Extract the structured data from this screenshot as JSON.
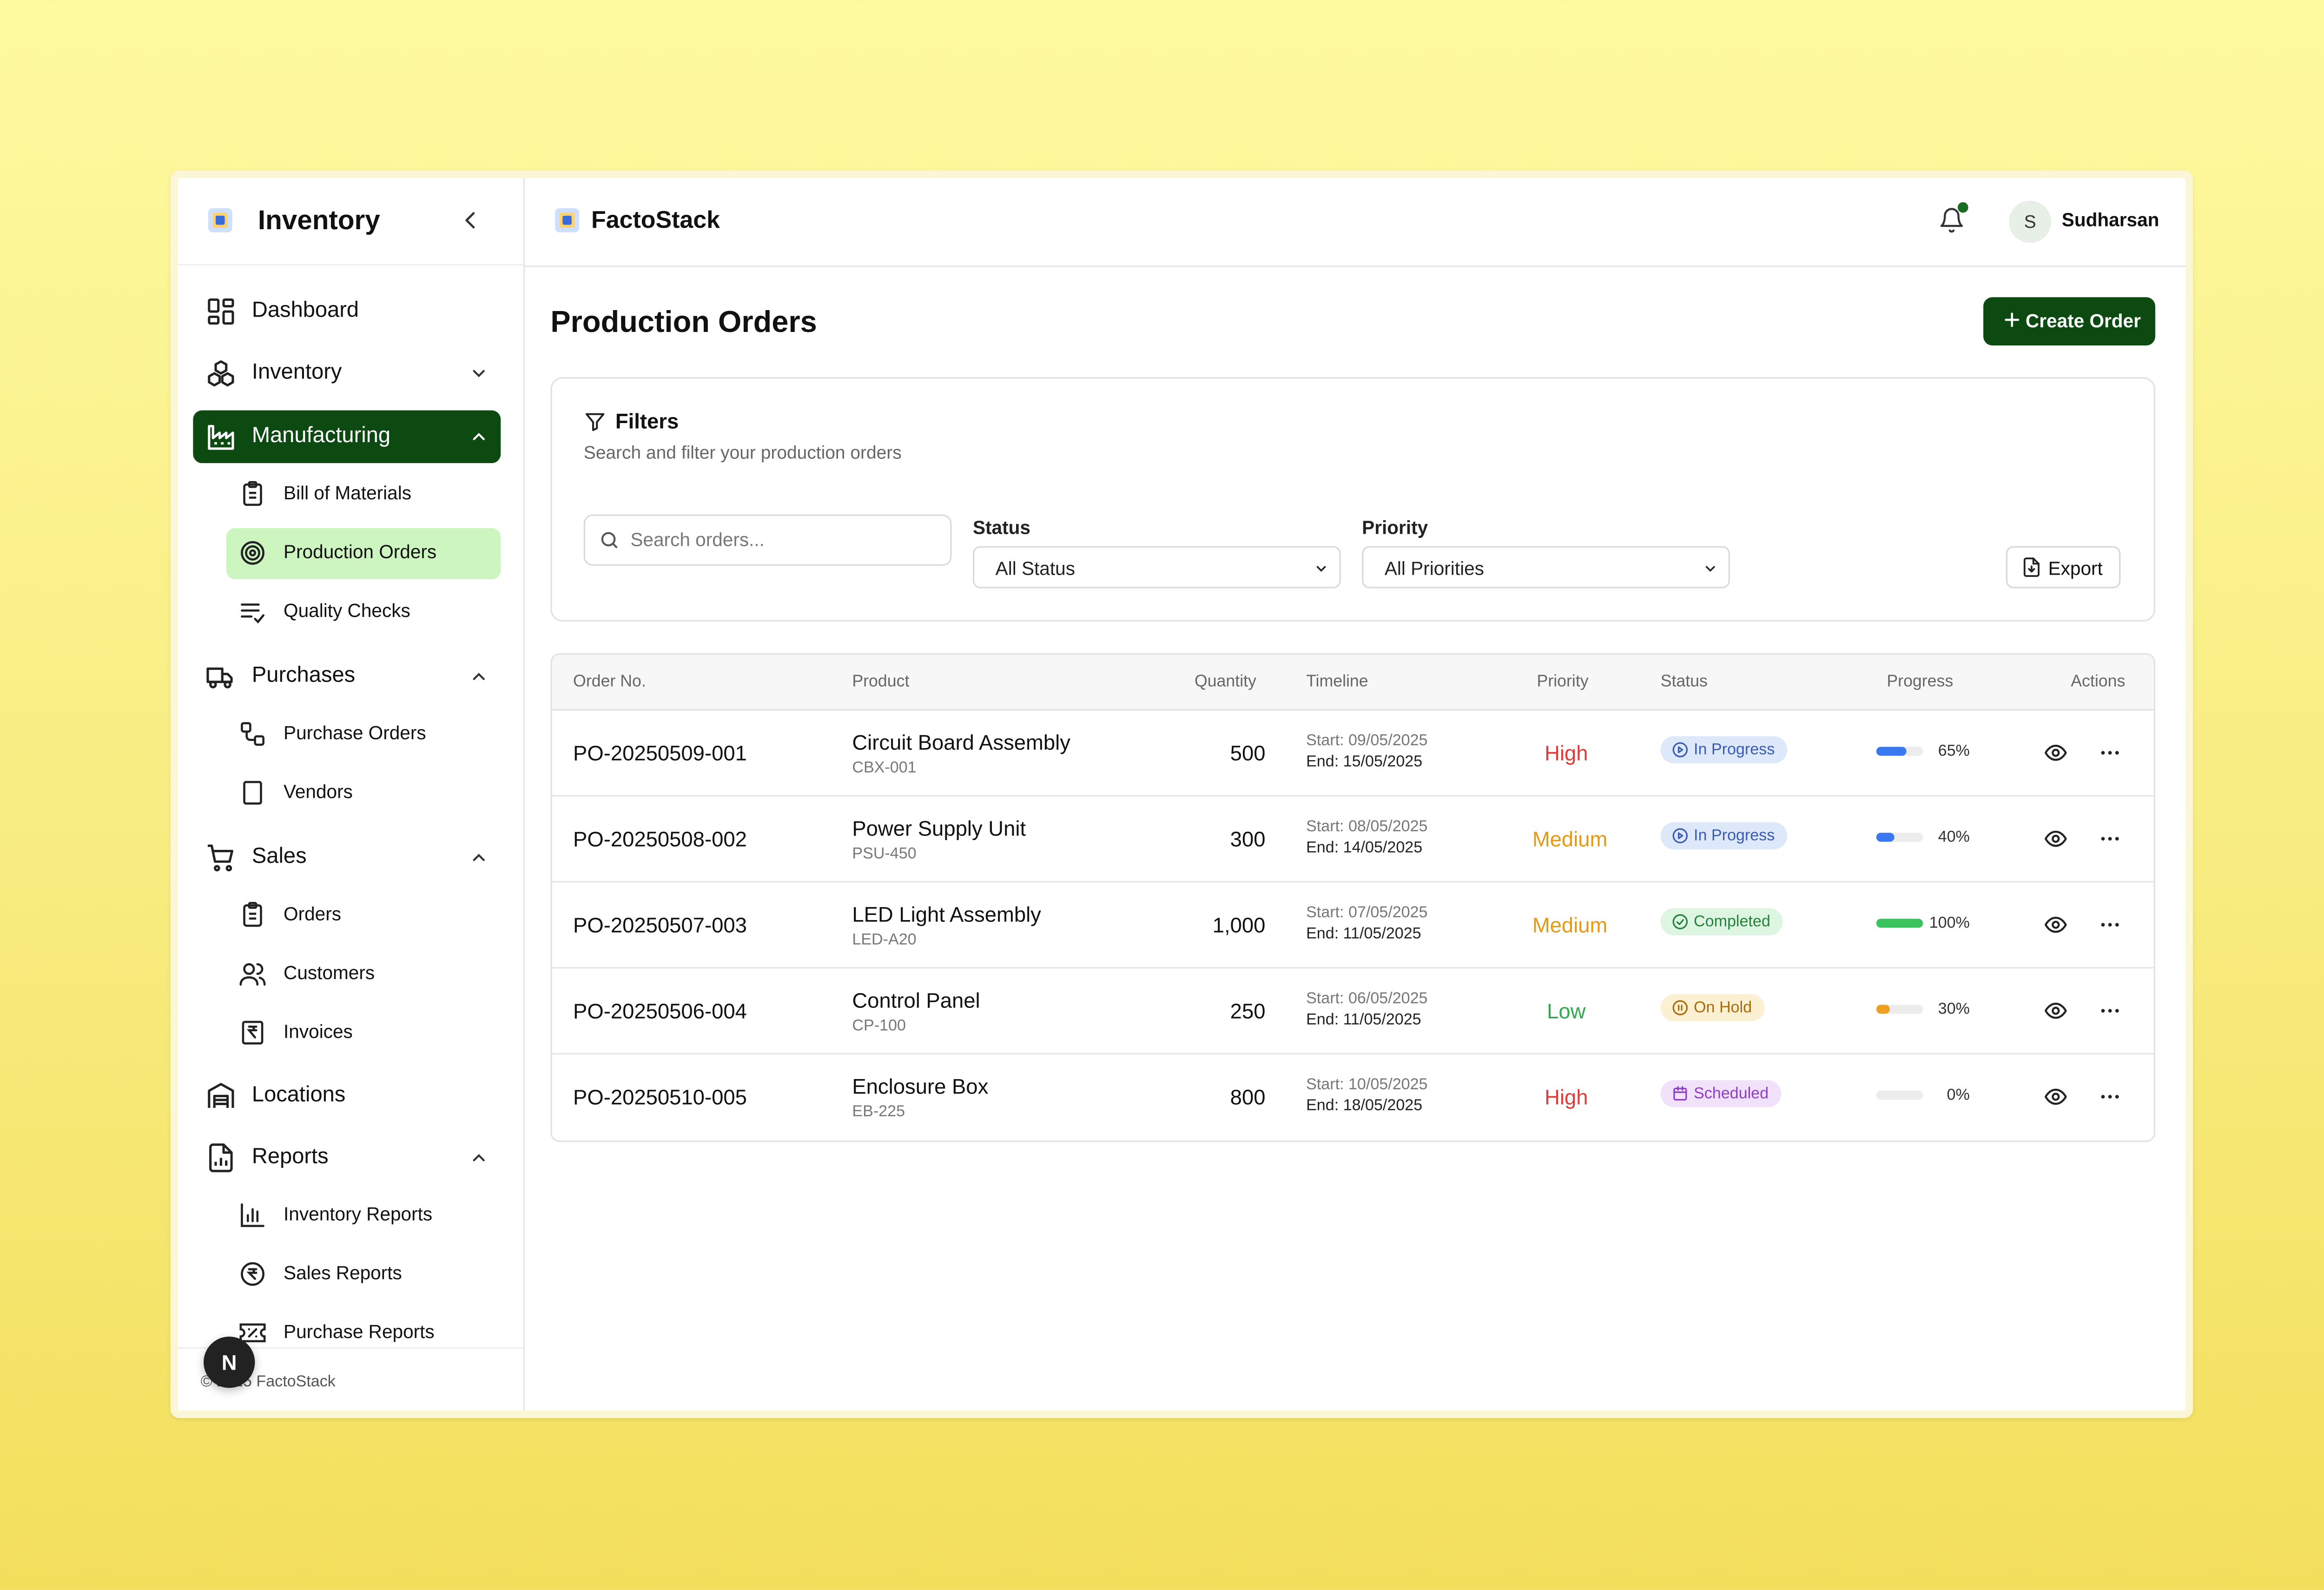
{
  "sidebar": {
    "title": "Inventory",
    "items": {
      "dashboard": "Dashboard",
      "inventory": "Inventory",
      "manufacturing": "Manufacturing",
      "bill_of_materials": "Bill of Materials",
      "production_orders": "Production Orders",
      "quality_checks": "Quality Checks",
      "purchases": "Purchases",
      "purchase_orders": "Purchase Orders",
      "vendors": "Vendors",
      "sales": "Sales",
      "orders": "Orders",
      "customers": "Customers",
      "invoices": "Invoices",
      "locations": "Locations",
      "reports": "Reports",
      "inventory_reports": "Inventory Reports",
      "sales_reports": "Sales Reports",
      "purchase_reports": "Purchase Reports"
    },
    "footer": "© 2025 FactoStack",
    "badge": "N"
  },
  "header": {
    "brand": "FactoStack",
    "user_initial": "S",
    "user_name": "Sudharsan"
  },
  "page": {
    "title": "Production Orders",
    "create_button": "Create Order"
  },
  "filters": {
    "title": "Filters",
    "subtitle": "Search and filter your production orders",
    "search_placeholder": "Search orders...",
    "status_label": "Status",
    "status_value": "All Status",
    "priority_label": "Priority",
    "priority_value": "All Priorities",
    "export": "Export"
  },
  "table": {
    "headers": [
      "Order No.",
      "Product",
      "Quantity",
      "Timeline",
      "Priority",
      "Status",
      "Progress",
      "Actions"
    ],
    "rows": [
      {
        "order": "PO-20250509-001",
        "product": "Circuit Board Assembly",
        "sku": "CBX-001",
        "qty": "500",
        "start": "Start: 09/05/2025",
        "end": "End: 15/05/2025",
        "priority": "High",
        "status": "In Progress",
        "progress": 65,
        "progress_label": "65%"
      },
      {
        "order": "PO-20250508-002",
        "product": "Power Supply Unit",
        "sku": "PSU-450",
        "qty": "300",
        "start": "Start: 08/05/2025",
        "end": "End: 14/05/2025",
        "priority": "Medium",
        "status": "In Progress",
        "progress": 40,
        "progress_label": "40%"
      },
      {
        "order": "PO-20250507-003",
        "product": "LED Light Assembly",
        "sku": "LED-A20",
        "qty": "1,000",
        "start": "Start: 07/05/2025",
        "end": "End: 11/05/2025",
        "priority": "Medium",
        "status": "Completed",
        "progress": 100,
        "progress_label": "100%"
      },
      {
        "order": "PO-20250506-004",
        "product": "Control Panel",
        "sku": "CP-100",
        "qty": "250",
        "start": "Start: 06/05/2025",
        "end": "End: 11/05/2025",
        "priority": "Low",
        "status": "On Hold",
        "progress": 30,
        "progress_label": "30%"
      },
      {
        "order": "PO-20250510-005",
        "product": "Enclosure Box",
        "sku": "EB-225",
        "qty": "800",
        "start": "Start: 10/05/2025",
        "end": "End: 18/05/2025",
        "priority": "High",
        "status": "Scheduled",
        "progress": 0,
        "progress_label": "0%"
      }
    ]
  },
  "colors": {
    "accent": "#0d4a12",
    "active_sub": "#cdf5c0",
    "priority_high": "#e03a3a",
    "priority_medium": "#e39a14",
    "priority_low": "#2fa84f",
    "in_progress_bg": "#dde8fb",
    "in_progress_fg": "#3b5bb0",
    "completed_bg": "#dcf6e2",
    "completed_fg": "#27803d",
    "on_hold_bg": "#fbf0d2",
    "on_hold_fg": "#a86c0a",
    "scheduled_bg": "#f1e1fb",
    "scheduled_fg": "#8c3fc0",
    "bar_blue": "#3a78f2",
    "bar_green": "#3cc25e",
    "bar_orange": "#f0a020"
  }
}
